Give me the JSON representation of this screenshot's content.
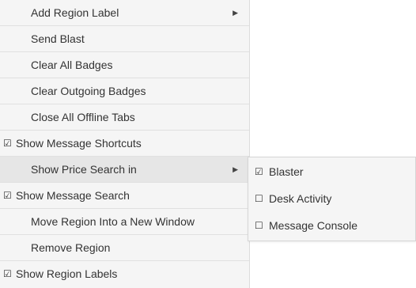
{
  "main_menu": {
    "items": [
      {
        "label": "Add Region Label",
        "checked": false,
        "submenu": true
      },
      {
        "label": "Send Blast",
        "checked": false,
        "submenu": false
      },
      {
        "label": "Clear All Badges",
        "checked": false,
        "submenu": false
      },
      {
        "label": "Clear Outgoing Badges",
        "checked": false,
        "submenu": false
      },
      {
        "label": "Close All Offline Tabs",
        "checked": false,
        "submenu": false
      },
      {
        "label": "Show Message Shortcuts",
        "checked": true,
        "submenu": false
      },
      {
        "label": "Show Price Search in",
        "checked": false,
        "submenu": true,
        "active": true
      },
      {
        "label": "Show Message Search",
        "checked": true,
        "submenu": false
      },
      {
        "label": "Move Region Into a New Window",
        "checked": false,
        "submenu": false
      },
      {
        "label": "Remove Region",
        "checked": false,
        "submenu": false
      },
      {
        "label": "Show Region Labels",
        "checked": true,
        "submenu": false
      }
    ]
  },
  "price_search_submenu": {
    "items": [
      {
        "label": "Blaster",
        "checked": true
      },
      {
        "label": "Desk Activity",
        "checked": false
      },
      {
        "label": "Message Console",
        "checked": false
      }
    ]
  },
  "icons": {
    "checked_box": "☑",
    "unchecked_box": "☐",
    "submenu_arrow": "▶",
    "checked_name": "checked-checkbox-icon",
    "unchecked_name": "unchecked-checkbox-icon",
    "arrow_name": "submenu-arrow-icon"
  }
}
